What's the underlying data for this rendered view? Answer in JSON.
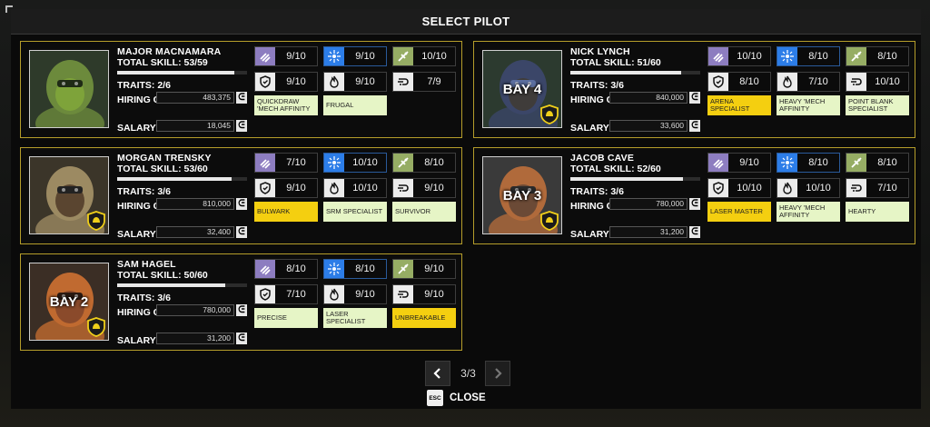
{
  "title": "SELECT PILOT",
  "pilots": [
    {
      "name": "MAJOR MACNAMARA",
      "skill_label": "TOTAL SKILL:",
      "skill": "53/59",
      "skill_fraction": 0.9,
      "traits_label": "TRAITS:",
      "traits": "2/6",
      "hiring_label": "HIRING COST",
      "hiring": "483,375",
      "salary_label": "SALARY",
      "salary": "18,045",
      "bay": "",
      "stats": [
        "9/10",
        "9/10",
        "10/10",
        "9/10",
        "9/10",
        "7/9"
      ],
      "quirks": [
        {
          "text": "QUICKDRAW 'MECH AFFINITY",
          "style": "light"
        },
        {
          "text": "FRUGAL",
          "style": "light"
        }
      ]
    },
    {
      "name": "NICK LYNCH",
      "skill_label": "TOTAL SKILL:",
      "skill": "51/60",
      "skill_fraction": 0.85,
      "traits_label": "TRAITS:",
      "traits": "3/6",
      "hiring_label": "HIRING COST",
      "hiring": "840,000",
      "salary_label": "SALARY",
      "salary": "33,600",
      "bay": "BAY 4",
      "stats": [
        "10/10",
        "8/10",
        "8/10",
        "8/10",
        "7/10",
        "10/10"
      ],
      "quirks": [
        {
          "text": "ARENA SPECIALIST",
          "style": "gold"
        },
        {
          "text": "HEAVY 'MECH AFFINITY",
          "style": "light"
        },
        {
          "text": "POINT BLANK SPECIALIST",
          "style": "light"
        }
      ]
    },
    {
      "name": "MORGAN TRENSKY",
      "skill_label": "TOTAL SKILL:",
      "skill": "53/60",
      "skill_fraction": 0.88,
      "traits_label": "TRAITS:",
      "traits": "3/6",
      "hiring_label": "HIRING COST",
      "hiring": "810,000",
      "salary_label": "SALARY",
      "salary": "32,400",
      "bay": "",
      "stats": [
        "7/10",
        "10/10",
        "8/10",
        "9/10",
        "10/10",
        "9/10"
      ],
      "quirks": [
        {
          "text": "BULWARK",
          "style": "gold"
        },
        {
          "text": "SRM SPECIALIST",
          "style": "light"
        },
        {
          "text": "SURVIVOR",
          "style": "light"
        }
      ]
    },
    {
      "name": "JACOB CAVE",
      "skill_label": "TOTAL SKILL:",
      "skill": "52/60",
      "skill_fraction": 0.87,
      "traits_label": "TRAITS:",
      "traits": "3/6",
      "hiring_label": "HIRING COST",
      "hiring": "780,000",
      "salary_label": "SALARY",
      "salary": "31,200",
      "bay": "BAY 3",
      "stats": [
        "9/10",
        "8/10",
        "8/10",
        "10/10",
        "10/10",
        "7/10"
      ],
      "quirks": [
        {
          "text": "LASER MASTER",
          "style": "gold"
        },
        {
          "text": "HEAVY 'MECH AFFINITY",
          "style": "light"
        },
        {
          "text": "HEARTY",
          "style": "light"
        }
      ]
    },
    {
      "name": "SAM HAGEL",
      "skill_label": "TOTAL SKILL:",
      "skill": "50/60",
      "skill_fraction": 0.83,
      "traits_label": "TRAITS:",
      "traits": "3/6",
      "hiring_label": "HIRING COST",
      "hiring": "780,000",
      "salary_label": "SALARY",
      "salary": "31,200",
      "bay": "BAY 2",
      "stats": [
        "8/10",
        "8/10",
        "9/10",
        "7/10",
        "9/10",
        "9/10"
      ],
      "quirks": [
        {
          "text": "PRECISE",
          "style": "light"
        },
        {
          "text": "LASER SPECIALIST",
          "style": "light"
        },
        {
          "text": "UNBREAKABLE",
          "style": "gold"
        }
      ]
    }
  ],
  "stat_icons": [
    "piloting-icon",
    "gunnery-icon",
    "medicine-icon",
    "guts-icon",
    "firepower-icon",
    "speed-icon"
  ],
  "pager": {
    "text": "3/3"
  },
  "close": {
    "key": "ESC",
    "label": "CLOSE"
  },
  "currency_symbol": "ᕮ"
}
